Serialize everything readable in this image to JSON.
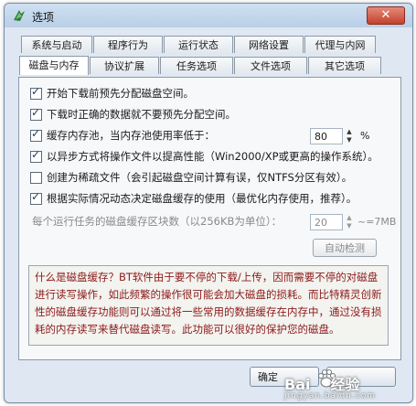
{
  "window": {
    "title": "选项",
    "close_label": "✕"
  },
  "tabs_row1": [
    "系统与启动",
    "程序行为",
    "运行状态",
    "网络设置",
    "代理与内网"
  ],
  "tabs_row2": [
    "磁盘与内存",
    "协议扩展",
    "任务选项",
    "文件选项",
    "其它选项"
  ],
  "active_tab": "磁盘与内存",
  "options": [
    {
      "label": "开始下载前预先分配磁盘空间。",
      "checked": true
    },
    {
      "label": "下载时正确的数据就不要预先分配空间。",
      "checked": true
    },
    {
      "label": "缓存内存池，当内存池使用率低于：",
      "checked": true
    },
    {
      "label": "以异步方式将操作文件以提高性能（Win2000/XP或更高的操作系统）。",
      "checked": true
    },
    {
      "label": "创建为稀疏文件（会引起磁盘空间计算有误，仅NTFS分区有效）。",
      "checked": false
    },
    {
      "label": "根据实际情况动态决定磁盘缓存的使用（最优化内存使用，推荐）。",
      "checked": true
    }
  ],
  "memory_pool": {
    "value": "80",
    "unit": "%"
  },
  "cache_blocks": {
    "label": "每个运行任务的磁盘缓存区块数（以256KB为单位）：",
    "value": "20",
    "approx": "~=7MB"
  },
  "auto_detect_label": "自动检测",
  "note_text": "什么是磁盘缓存？BT软件由于要不停的下载/上传，因而需要不停的对磁盘进行读写操作，如此频繁的操作很可能会加大磁盘的损耗。而比特精灵创新性的磁盘缓存功能则可以通过将一些常用的数据缓存在内存中，通过没有损耗的内存读写来替代磁盘读写。此功能可以很好的保护您的磁盘。",
  "footer": {
    "ok_label": "确定"
  },
  "watermark": {
    "brand": "Bai",
    "brand2": "经验",
    "url": "jingyan.baidu.com"
  },
  "colors": {
    "note_text": "#8b1a1a",
    "close_button": "#c4412d"
  }
}
